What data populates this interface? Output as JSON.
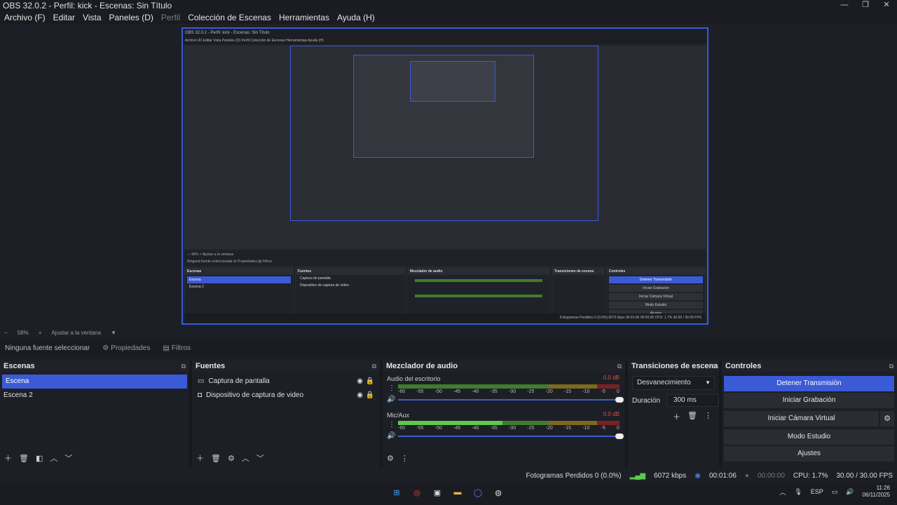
{
  "window": {
    "title": "OBS 32.0.2 - Perfil: kick - Escenas: Sin Título",
    "min": "—",
    "max": "❐",
    "close": "✕"
  },
  "menu": [
    "Archivo (F)",
    "Editar",
    "Vista",
    "Paneles (D)",
    "Perfil",
    "Colección de Escenas",
    "Herramientas",
    "Ayuda (H)"
  ],
  "nested": {
    "title": "OBS 32.0.2 - Perfil: kick - Escenas: Sin Título",
    "menu": "Archivo (F)   Editar   Vista   Paneles (D)   Perfil   Colección de Escenas   Herramientas   Ayuda (H)",
    "previewbar": "—  58%  +  Ajustar a la ventana",
    "sourcebar": "Ninguna fuente seleccionada   ⚙ Propiedades   ▤ Filtros",
    "docks": {
      "escenas": "Escenas",
      "fuentes": "Fuentes",
      "mezclador": "Mezclador de audio",
      "transiciones": "Transiciones de escena",
      "controles": "Controles"
    },
    "scene1": "Escena",
    "scene2": "Escena 2",
    "src1": "Captura de pantalla",
    "src2": "Dispositivo de captura de vídeo",
    "ctrl": [
      "Detener Transmisión",
      "Iniciar Grabación",
      "Iniciar Cámara Virtual",
      "Modo Estudio",
      "Ajustes"
    ],
    "status": "Fotogramas Perdidos 0 (0.0%)   6072 kbps   00:01:06   00:00:00   CPU: 1.7%   30.00 / 30.00 FPS"
  },
  "previewbar": {
    "minus": "−",
    "zoom": "58%",
    "plus": "+",
    "fit": "Ajustar a la ventana",
    "arrow": "▼"
  },
  "sourcebar": {
    "none": "Ninguna fuente seleccionar",
    "props": "Propiedades",
    "filters": "Filtros"
  },
  "scenes": {
    "title": "Escenas",
    "items": [
      "Escena",
      "Escena 2"
    ]
  },
  "sources": {
    "title": "Fuentes",
    "items": [
      "Captura de pantalla",
      "Dispositivo de captura de video"
    ]
  },
  "mixer": {
    "title": "Mezclador de audio",
    "channels": [
      {
        "name": "Audio del escritorio",
        "db": "0.0 dB",
        "level": 0
      },
      {
        "name": "Mic/Aux",
        "db": "0.0 dB",
        "level": 0.47
      }
    ],
    "ticks": [
      "-60",
      "-55",
      "-50",
      "-45",
      "-40",
      "-35",
      "-30",
      "-25",
      "-20",
      "-15",
      "-10",
      "-5",
      "0"
    ]
  },
  "transitions": {
    "title": "Transiciones de escena",
    "selected": "Desvanecimiento",
    "duration_label": "Duración",
    "duration": "300 ms"
  },
  "controls": {
    "title": "Controles",
    "buttons": [
      "Detener Transmisión",
      "Iniciar Grabación",
      "Iniciar Cámara Virtual",
      "Modo Estudio",
      "Ajustes"
    ]
  },
  "status": {
    "dropped": "Fotogramas Perdidos 0 (0.0%)",
    "kbps": "6072 kbps",
    "stream_time": "00:01:06",
    "rec_time": "00:00:00",
    "cpu": "CPU: 1.7%",
    "fps": "30.00 / 30.00 FPS"
  },
  "tray": {
    "lang": "ESP",
    "time": "11:26",
    "date": "06/11/2025"
  },
  "colors": {
    "accent": "#3b5ad6",
    "bg": "#1d1f26"
  }
}
